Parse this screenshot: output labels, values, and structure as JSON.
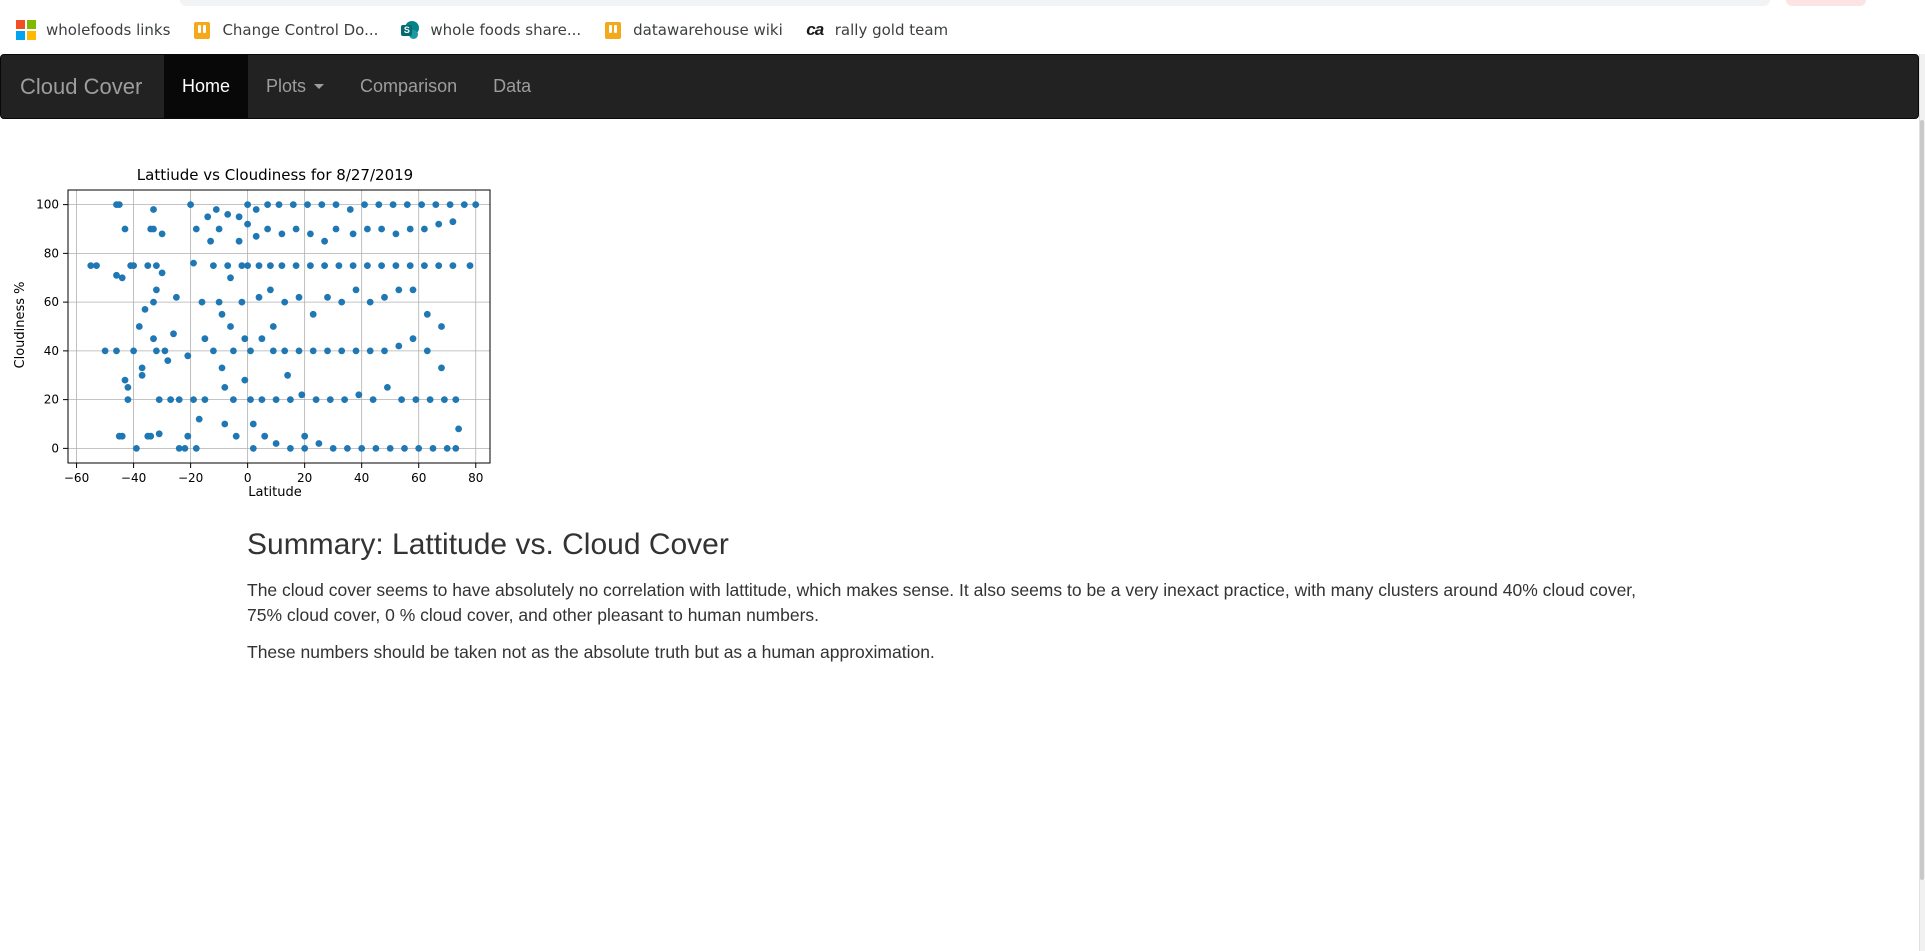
{
  "browser": {
    "bookmarks": [
      {
        "label": "wholefoods links",
        "icon": "microsoft-logo-icon"
      },
      {
        "label": "Change Control Do...",
        "icon": "shopping-bag-icon"
      },
      {
        "label": "whole foods share...",
        "icon": "sharepoint-icon"
      },
      {
        "label": "datawarehouse wiki",
        "icon": "shopping-bag-icon"
      },
      {
        "label": "rally gold team",
        "icon": "ca-logo-icon"
      }
    ]
  },
  "navbar": {
    "brand": "Cloud Cover",
    "items": [
      {
        "label": "Home",
        "active": true
      },
      {
        "label": "Plots",
        "dropdown": true
      },
      {
        "label": "Comparison"
      },
      {
        "label": "Data"
      }
    ]
  },
  "chart_data": {
    "type": "scatter",
    "title": "Lattiude vs Cloudiness for 8/27/2019",
    "xlabel": "Latitude",
    "ylabel": "Cloudiness %",
    "xlim": [
      -63,
      85
    ],
    "ylim": [
      -6,
      106
    ],
    "xticks": [
      -60,
      -40,
      -20,
      0,
      20,
      40,
      60,
      80
    ],
    "yticks": [
      0,
      20,
      40,
      60,
      80,
      100
    ],
    "grid": true,
    "marker_color": "#1f77b4",
    "points": [
      [
        -55,
        75
      ],
      [
        -53,
        75
      ],
      [
        -50,
        40
      ],
      [
        -46,
        100
      ],
      [
        -45,
        100
      ],
      [
        -46,
        71
      ],
      [
        -44,
        70
      ],
      [
        -43,
        90
      ],
      [
        -46,
        40
      ],
      [
        -45,
        5
      ],
      [
        -44,
        5
      ],
      [
        -42,
        20
      ],
      [
        -42,
        25
      ],
      [
        -43,
        28
      ],
      [
        -41,
        75
      ],
      [
        -40,
        75
      ],
      [
        -40,
        40
      ],
      [
        -39,
        0
      ],
      [
        -38,
        50
      ],
      [
        -37,
        33
      ],
      [
        -37,
        30
      ],
      [
        -36,
        57
      ],
      [
        -35,
        5
      ],
      [
        -34,
        5
      ],
      [
        -35,
        75
      ],
      [
        -34,
        90
      ],
      [
        -33,
        98
      ],
      [
        -33,
        90
      ],
      [
        -32,
        75
      ],
      [
        -32,
        65
      ],
      [
        -33,
        60
      ],
      [
        -33,
        45
      ],
      [
        -32,
        40
      ],
      [
        -31,
        20
      ],
      [
        -31,
        6
      ],
      [
        -30,
        88
      ],
      [
        -30,
        72
      ],
      [
        -29,
        40
      ],
      [
        -28,
        36
      ],
      [
        -27,
        20
      ],
      [
        -26,
        47
      ],
      [
        -25,
        62
      ],
      [
        -24,
        20
      ],
      [
        -24,
        0
      ],
      [
        -22,
        0
      ],
      [
        -21,
        5
      ],
      [
        -21,
        38
      ],
      [
        -20,
        100
      ],
      [
        -19,
        76
      ],
      [
        -19,
        20
      ],
      [
        -18,
        90
      ],
      [
        -18,
        0
      ],
      [
        -17,
        12
      ],
      [
        -16,
        60
      ],
      [
        -15,
        45
      ],
      [
        -15,
        20
      ],
      [
        -14,
        95
      ],
      [
        -13,
        85
      ],
      [
        -12,
        75
      ],
      [
        -12,
        40
      ],
      [
        -11,
        98
      ],
      [
        -10,
        90
      ],
      [
        -10,
        60
      ],
      [
        -9,
        55
      ],
      [
        -9,
        33
      ],
      [
        -8,
        25
      ],
      [
        -8,
        10
      ],
      [
        -7,
        96
      ],
      [
        -7,
        75
      ],
      [
        -6,
        70
      ],
      [
        -6,
        50
      ],
      [
        -5,
        40
      ],
      [
        -5,
        20
      ],
      [
        -4,
        5
      ],
      [
        -3,
        95
      ],
      [
        -3,
        85
      ],
      [
        -2,
        75
      ],
      [
        -2,
        60
      ],
      [
        -1,
        45
      ],
      [
        -1,
        28
      ],
      [
        0,
        100
      ],
      [
        0,
        92
      ],
      [
        0,
        75
      ],
      [
        1,
        40
      ],
      [
        1,
        20
      ],
      [
        2,
        10
      ],
      [
        2,
        0
      ],
      [
        3,
        98
      ],
      [
        3,
        87
      ],
      [
        4,
        75
      ],
      [
        4,
        62
      ],
      [
        5,
        45
      ],
      [
        5,
        20
      ],
      [
        6,
        5
      ],
      [
        7,
        100
      ],
      [
        7,
        90
      ],
      [
        8,
        75
      ],
      [
        8,
        65
      ],
      [
        9,
        50
      ],
      [
        9,
        40
      ],
      [
        10,
        20
      ],
      [
        10,
        2
      ],
      [
        11,
        100
      ],
      [
        12,
        88
      ],
      [
        12,
        75
      ],
      [
        13,
        60
      ],
      [
        13,
        40
      ],
      [
        14,
        30
      ],
      [
        15,
        20
      ],
      [
        15,
        0
      ],
      [
        16,
        100
      ],
      [
        17,
        90
      ],
      [
        17,
        75
      ],
      [
        18,
        62
      ],
      [
        18,
        40
      ],
      [
        19,
        22
      ],
      [
        20,
        5
      ],
      [
        20,
        0
      ],
      [
        21,
        100
      ],
      [
        22,
        88
      ],
      [
        22,
        75
      ],
      [
        23,
        55
      ],
      [
        23,
        40
      ],
      [
        24,
        20
      ],
      [
        25,
        2
      ],
      [
        26,
        100
      ],
      [
        27,
        85
      ],
      [
        27,
        75
      ],
      [
        28,
        62
      ],
      [
        28,
        40
      ],
      [
        29,
        20
      ],
      [
        30,
        0
      ],
      [
        31,
        100
      ],
      [
        31,
        90
      ],
      [
        32,
        75
      ],
      [
        33,
        60
      ],
      [
        33,
        40
      ],
      [
        34,
        20
      ],
      [
        35,
        0
      ],
      [
        36,
        98
      ],
      [
        37,
        88
      ],
      [
        37,
        75
      ],
      [
        38,
        65
      ],
      [
        38,
        40
      ],
      [
        39,
        22
      ],
      [
        40,
        0
      ],
      [
        41,
        100
      ],
      [
        42,
        90
      ],
      [
        42,
        75
      ],
      [
        43,
        60
      ],
      [
        43,
        40
      ],
      [
        44,
        20
      ],
      [
        45,
        0
      ],
      [
        46,
        100
      ],
      [
        47,
        90
      ],
      [
        47,
        75
      ],
      [
        48,
        62
      ],
      [
        48,
        40
      ],
      [
        49,
        25
      ],
      [
        50,
        0
      ],
      [
        51,
        100
      ],
      [
        52,
        88
      ],
      [
        52,
        75
      ],
      [
        53,
        65
      ],
      [
        53,
        42
      ],
      [
        54,
        20
      ],
      [
        55,
        0
      ],
      [
        56,
        100
      ],
      [
        57,
        90
      ],
      [
        57,
        75
      ],
      [
        58,
        65
      ],
      [
        58,
        45
      ],
      [
        59,
        20
      ],
      [
        60,
        0
      ],
      [
        61,
        100
      ],
      [
        62,
        90
      ],
      [
        62,
        75
      ],
      [
        63,
        55
      ],
      [
        63,
        40
      ],
      [
        64,
        20
      ],
      [
        65,
        0
      ],
      [
        66,
        100
      ],
      [
        67,
        92
      ],
      [
        67,
        75
      ],
      [
        68,
        50
      ],
      [
        68,
        33
      ],
      [
        69,
        20
      ],
      [
        70,
        0
      ],
      [
        71,
        100
      ],
      [
        72,
        93
      ],
      [
        72,
        75
      ],
      [
        73,
        20
      ],
      [
        73,
        0
      ],
      [
        74,
        8
      ],
      [
        76,
        100
      ],
      [
        78,
        75
      ],
      [
        80,
        100
      ]
    ]
  },
  "summary": {
    "title": "Summary: Lattitude vs. Cloud Cover",
    "paragraph1": "The cloud cover seems to have absolutely no correlation with lattitude, which makes sense. It also seems to be a very inexact practice, with many clusters around 40% cloud cover, 75% cloud cover, 0 % cloud cover, and other pleasant to human numbers.",
    "paragraph2": "These numbers should be taken not as the absolute truth but as a human approximation."
  }
}
